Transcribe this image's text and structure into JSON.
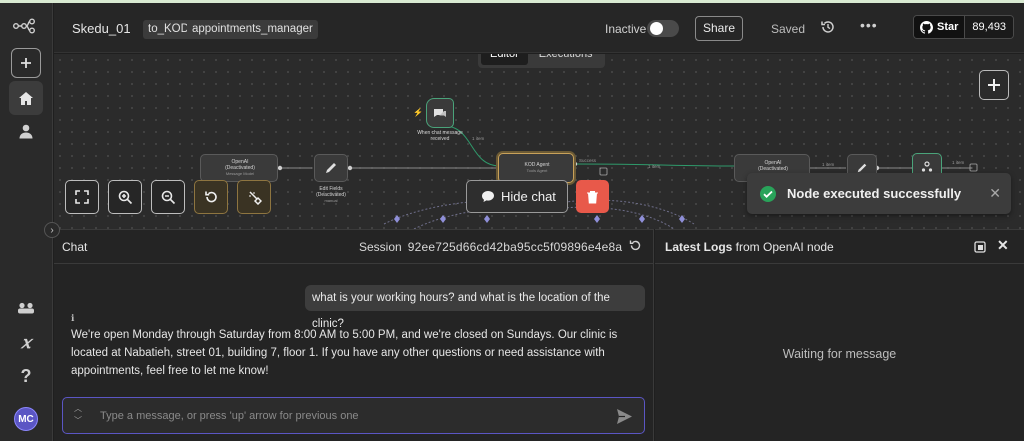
{
  "app": {
    "workflow_name": "Skedu_01",
    "tags": [
      "to_KOD",
      "appointments_manager"
    ],
    "status_label": "Inactive",
    "share_label": "Share",
    "saved_label": "Saved",
    "github": {
      "star_label": "Star",
      "star_count": "89,493"
    },
    "accent_color": "#5b56c4"
  },
  "sidebar": {
    "items": [
      "logo-icon",
      "add-icon",
      "home-icon",
      "user-icon",
      "templates-icon",
      "variables-icon",
      "help-icon"
    ],
    "variables_symbol": "𝑥",
    "help_symbol": "?",
    "avatar_initials": "MC"
  },
  "canvas": {
    "tabs": [
      {
        "label": "Editor",
        "active": true
      },
      {
        "label": "Executions",
        "active": false
      }
    ],
    "nodes": [
      {
        "title": "OpenAI",
        "sub1": "(Deactivated)",
        "sub2": "Message Model"
      },
      {
        "title": "Edit Fields",
        "sub1": "(Deactivated)",
        "sub2": "manual"
      },
      {
        "title": "When chat message",
        "sub1": "received",
        "sub2": ""
      },
      {
        "title": "KOD Agent",
        "sub1": "Tools Agent",
        "sub2": ""
      },
      {
        "title": "OpenAI",
        "sub1": "(Deactivated)",
        "sub2": ""
      }
    ],
    "edge_labels": [
      "1 item",
      "1 item",
      "1 item",
      "1 item",
      "Success"
    ],
    "hide_chat_label": "Hide chat",
    "toast": {
      "message": "Node executed successfully",
      "status_color": "#29a35a"
    }
  },
  "chat": {
    "title": "Chat",
    "session_label": "Session",
    "session_id": "92ee725d66cd42ba95cc5f09896e4e8a",
    "user_message": "what is your working hours? and what is the location of the clinic?",
    "info_mark": "ℹ",
    "bot_message": "We're open Monday through Saturday from 8:00 AM to 5:00 PM, and we're closed on Sundays. Our clinic is located at Nabatieh, street 01, building 7, floor 1. If you have any other questions or need assistance with appointments, feel free to let me know!",
    "input_placeholder": "Type a message, or press 'up' arrow for previous one"
  },
  "logs": {
    "title_bold": "Latest Logs",
    "title_rest": " from OpenAI node",
    "waiting_text": "Waiting for message"
  }
}
